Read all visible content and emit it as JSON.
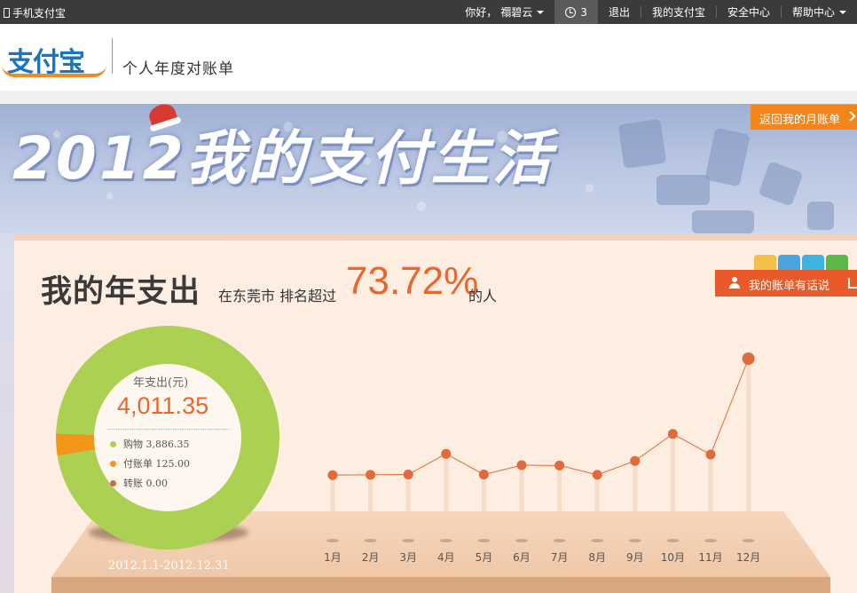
{
  "topbar": {
    "mobile_label": "手机支付宝",
    "greeting": "你好，",
    "username": "禤碧云",
    "alarm_count": "3",
    "logout": "退出",
    "my_alipay": "我的支付宝",
    "security": "安全中心",
    "help": "帮助中心"
  },
  "header": {
    "logo_text": "支付宝",
    "page_title": "个人年度对账单"
  },
  "banner": {
    "title": "2012我的支付生活",
    "return_label": "返回我的月账单"
  },
  "summary": {
    "headline": "我的年支出",
    "sub_prefix": "在东莞市 排名超过",
    "percent": "73.72%",
    "sub_suffix": "的人",
    "say_button": "我的账单有话说"
  },
  "donut": {
    "label": "年支出(元)",
    "total": "4,011.35",
    "items": [
      {
        "label": "购物 3,886.35",
        "value": 3886.35,
        "color": "#abd052"
      },
      {
        "label": "付账单 125.00",
        "value": 125.0,
        "color": "#f39518"
      },
      {
        "label": "转账 0.00",
        "value": 0.0,
        "color": "#d9683e"
      }
    ],
    "date_range": "2012.1.1-2012.12.31"
  },
  "colors": {
    "accent": "#e8672f",
    "orange_button": "#f2861d",
    "line": "#e8672f"
  },
  "chart_data": {
    "type": "line",
    "categories": [
      "1月",
      "2月",
      "3月",
      "4月",
      "5月",
      "6月",
      "7月",
      "8月",
      "9月",
      "10月",
      "11月",
      "12月"
    ],
    "values": [
      230,
      232,
      234,
      380,
      234,
      300,
      298,
      232,
      330,
      520,
      375,
      1050
    ],
    "ylim": [
      0,
      1100
    ],
    "grid": false,
    "legend": "none"
  }
}
